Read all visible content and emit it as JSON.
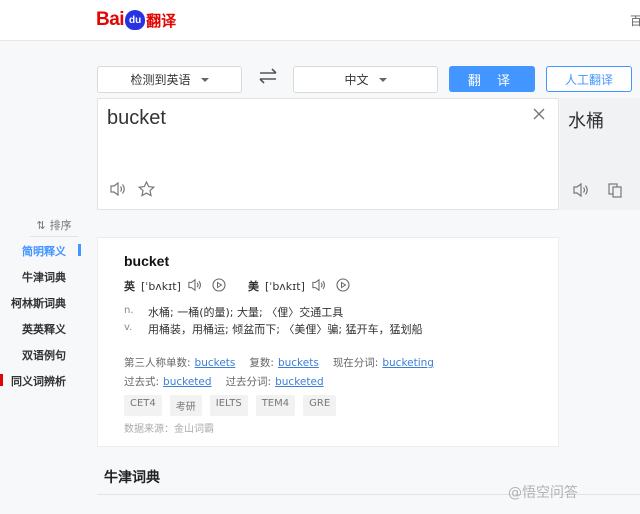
{
  "header": {
    "logo_text": "Baidu翻译",
    "top_right": "百"
  },
  "toolbar": {
    "source_lang": "检测到英语",
    "target_lang": "中文",
    "translate_label": "翻 译",
    "human_label": "人工翻译"
  },
  "input": {
    "text": "bucket"
  },
  "output": {
    "text": "水桶"
  },
  "sidebar": {
    "sort_label": "排序",
    "items": [
      {
        "label": "简明释义",
        "active": true
      },
      {
        "label": "牛津词典"
      },
      {
        "label": "柯林斯词典"
      },
      {
        "label": "英英释义"
      },
      {
        "label": "双语例句"
      },
      {
        "label": "同义词辨析"
      }
    ]
  },
  "dict": {
    "word": "bucket",
    "uk_label": "英",
    "uk_phonetic": "[ˈbʌkɪt]",
    "us_label": "美",
    "us_phonetic": "[ˈbʌkɪt]",
    "definitions": [
      {
        "pos": "n.",
        "text": "水桶; 一桶(的量); 大量; 〈俚〉交通工具"
      },
      {
        "pos": "v.",
        "text": "用桶装，用桶运; 倾盆而下; 〈美俚〉骗; 猛开车，猛划船"
      }
    ],
    "forms_line1": [
      {
        "label": "第三人称单数:",
        "value": "buckets"
      },
      {
        "label": "复数:",
        "value": "buckets"
      },
      {
        "label": "现在分词:",
        "value": "bucketing"
      }
    ],
    "forms_line2": [
      {
        "label": "过去式:",
        "value": "bucketed"
      },
      {
        "label": "过去分词:",
        "value": "bucketed"
      }
    ],
    "tags": [
      "CET4",
      "考研",
      "IELTS",
      "TEM4",
      "GRE"
    ],
    "source": "数据来源：金山词霸"
  },
  "section": {
    "oxford_title": "牛津词典"
  },
  "watermark": "@悟空问答",
  "colors": {
    "accent": "#4395ff",
    "logo_red": "#e10602",
    "logo_blue": "#2932e1",
    "link": "#3b7ed8"
  }
}
